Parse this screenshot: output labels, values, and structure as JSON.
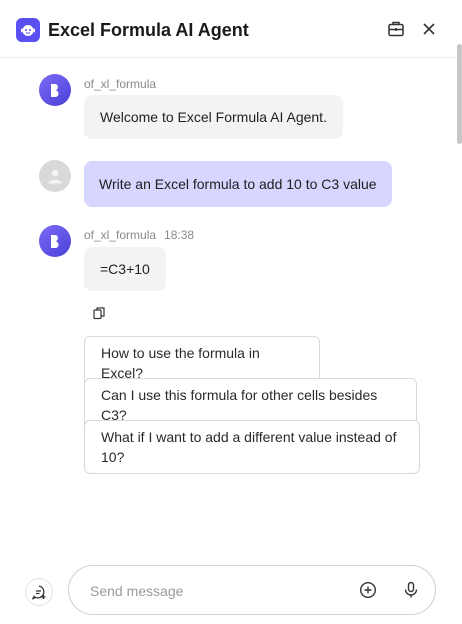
{
  "header": {
    "title": "Excel Formula AI Agent",
    "icons": {
      "logo": "bot-face-icon",
      "briefcase": "briefcase-icon",
      "close": "close-icon"
    }
  },
  "messages": [
    {
      "role": "bot",
      "sender": "of_xl_formula",
      "time": "",
      "text": "Welcome to Excel Formula AI Agent."
    },
    {
      "role": "user",
      "sender": "",
      "time": "",
      "text": "Write an Excel formula to add 10 to C3 value"
    },
    {
      "role": "bot",
      "sender": "of_xl_formula",
      "time": "18:38",
      "text": "=C3+10"
    }
  ],
  "suggestions": [
    "How to use the formula in Excel?",
    "Can I use this formula for other cells besides C3?",
    "What if I want to add a different value instead of 10?"
  ],
  "composer": {
    "placeholder": "Send message",
    "icons": {
      "new_chat": "new-chat-icon",
      "add": "plus-circle-icon",
      "mic": "microphone-icon"
    }
  },
  "colors": {
    "accent": "#5a4ff0",
    "user_bubble": "#d6d6ff",
    "bot_bubble": "#f2f3f5"
  }
}
